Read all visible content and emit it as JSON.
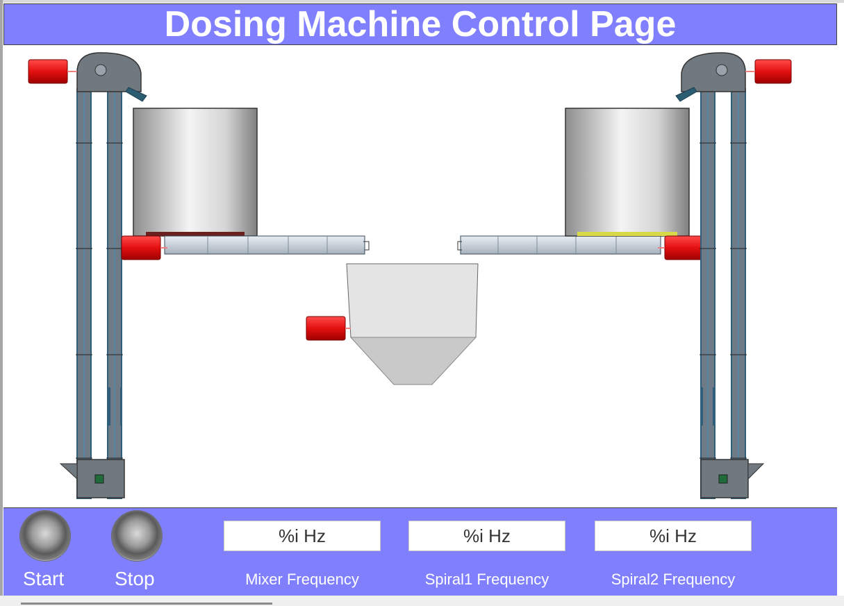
{
  "title": "Dosing Machine Control Page",
  "controls": {
    "start_label": "Start",
    "stop_label": "Stop"
  },
  "frequencies": [
    {
      "value": "%i Hz",
      "label": "Mixer Frequency"
    },
    {
      "value": "%i Hz",
      "label": "Spiral1 Frequency"
    },
    {
      "value": "%i Hz",
      "label": "Spiral2 Frequency"
    }
  ],
  "colors": {
    "title_bar": "#8080ff",
    "motor": "#e01010",
    "elevator": "#6e7b87",
    "silo": "#b9b9b9",
    "mixer": "#d9d9d9"
  },
  "icons": [
    "motor-icon",
    "bucket-elevator-icon",
    "silo-icon",
    "screw-conveyor-icon",
    "mixer-icon"
  ]
}
